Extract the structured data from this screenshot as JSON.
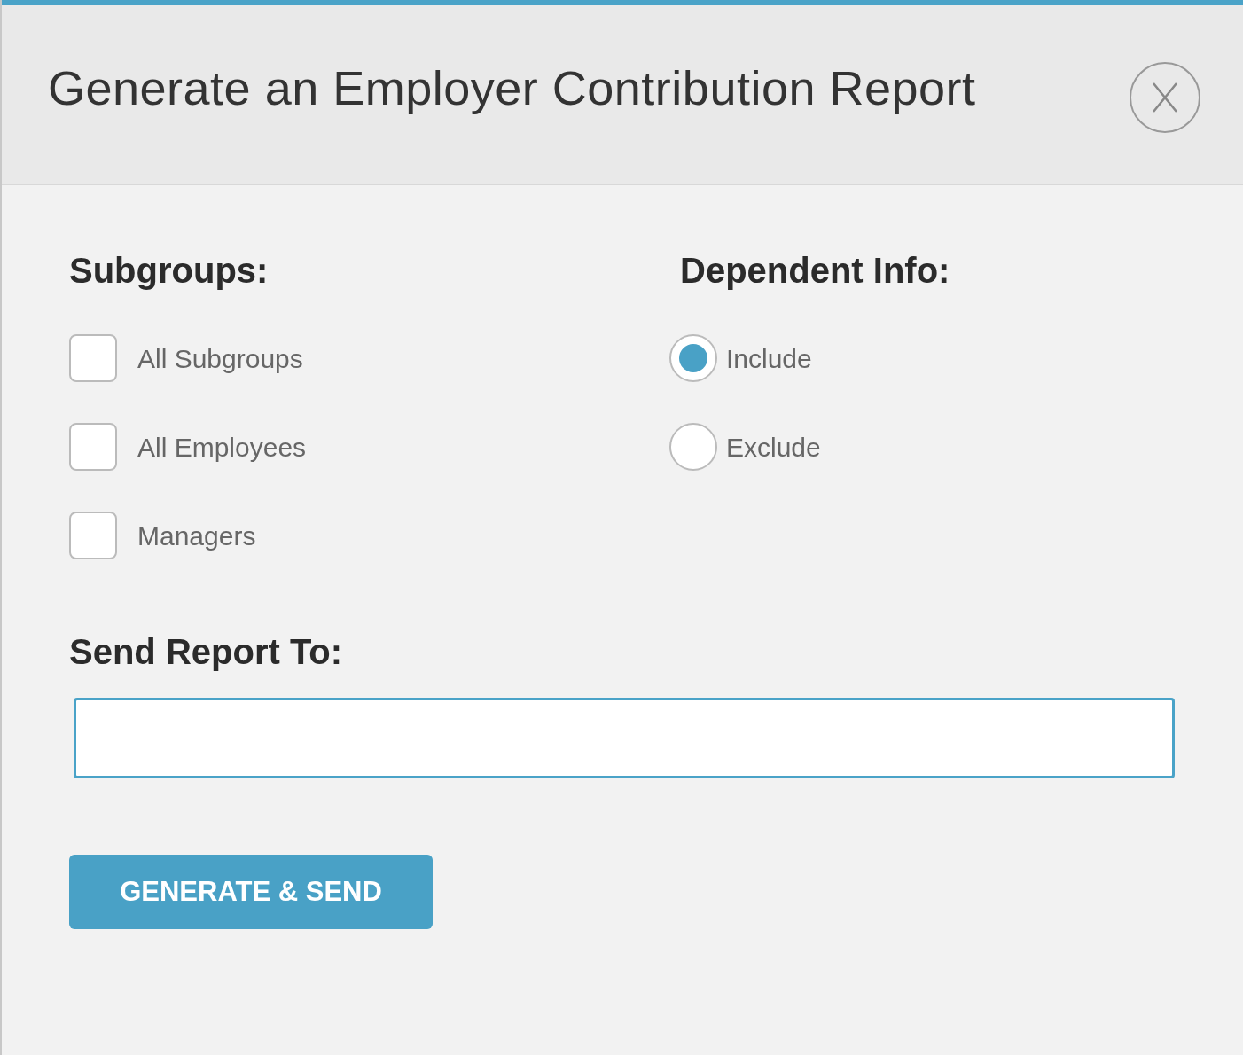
{
  "dialog": {
    "title": "Generate an Employer Contribution Report"
  },
  "subgroups": {
    "heading": "Subgroups:",
    "options": [
      {
        "label": "All Subgroups",
        "checked": false
      },
      {
        "label": "All Employees",
        "checked": false
      },
      {
        "label": "Managers",
        "checked": false
      }
    ]
  },
  "dependent_info": {
    "heading": "Dependent Info:",
    "options": [
      {
        "label": "Include",
        "selected": true
      },
      {
        "label": "Exclude",
        "selected": false
      }
    ]
  },
  "send_report_to": {
    "heading": "Send Report To:",
    "focused": true
  },
  "submit_button": {
    "label": "GENERATE & SEND"
  }
}
